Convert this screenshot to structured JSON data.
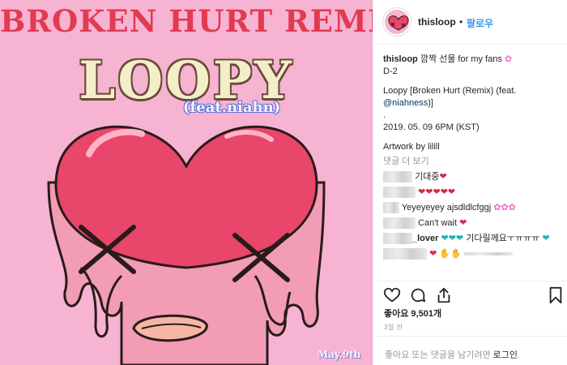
{
  "artwork": {
    "banner": "BROKEN HURT REMIX",
    "logo": "LOOPY",
    "feat": "(feat.niahn)",
    "date": "May.9th",
    "colors": {
      "background": "#f6b3d2",
      "banner": "#e23a52",
      "heart": "#e8466a"
    }
  },
  "header": {
    "username": "thisloop",
    "separator": "•",
    "follow": "팔로우"
  },
  "caption": {
    "username": "thisloop",
    "text1": "깜짝 선물 for my fans",
    "text2": "D-2",
    "line3": "Loopy [Broken Hurt (Remix) (feat.",
    "mention": "@niahness",
    "line3_end": ")]",
    "dot": ".",
    "datetime": "2019. 05. 09 6PM (KST)",
    "artwork_by": "Artwork by lilill",
    "more_comments": "댓글 더 보기"
  },
  "comments": [
    {
      "text": "기대중",
      "emoji": "❤"
    },
    {
      "text": "",
      "emoji": "❤❤❤❤❤"
    },
    {
      "text": "Yeyeyeyey ajsdldlcfggj",
      "emoji": "✿✿✿"
    },
    {
      "text": "Can't wait",
      "emoji": "❤"
    },
    {
      "user_suffix": "_lover",
      "text": "기다릴께요ㅜㅠㅠㅠ",
      "emoji_pre": "❤❤❤",
      "emoji_post": "❤"
    },
    {
      "text": "",
      "emoji": "❤ ✋✋"
    }
  ],
  "actions": {
    "like_icon": "heart-outline-icon",
    "comment_icon": "comment-bubble-icon",
    "share_icon": "share-arrow-icon",
    "save_icon": "bookmark-icon"
  },
  "likes": "좋아요 9,501개",
  "time_ago": "3일 전",
  "login_prompt": {
    "prefix": "좋아요 또는 댓글을 남기려면 ",
    "link": "로그인",
    "suffix": "."
  }
}
